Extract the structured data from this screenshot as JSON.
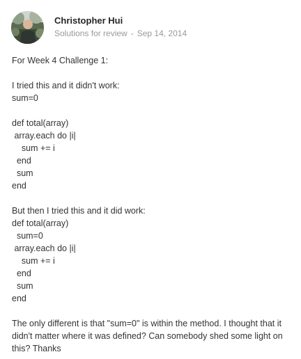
{
  "post": {
    "author": "Christopher Hui",
    "category": "Solutions for review",
    "separator": "-",
    "date": "Sep 14, 2014",
    "lines": [
      "For Week 4 Challenge 1:",
      "",
      "I tried this and it didn't work:",
      "sum=0",
      "",
      "def total(array)",
      " array.each do |i|",
      "    sum += i",
      "  end",
      "  sum",
      "end",
      "",
      "But then I tried this and it did work:",
      "def total(array)",
      "  sum=0",
      " array.each do |i|",
      "    sum += i",
      "  end",
      "  sum",
      "end",
      ""
    ],
    "closing": "The only different is that \"sum=0\" is within the method. I thought that it didn't matter where it was defined? Can somebody shed some light on this? Thanks"
  }
}
